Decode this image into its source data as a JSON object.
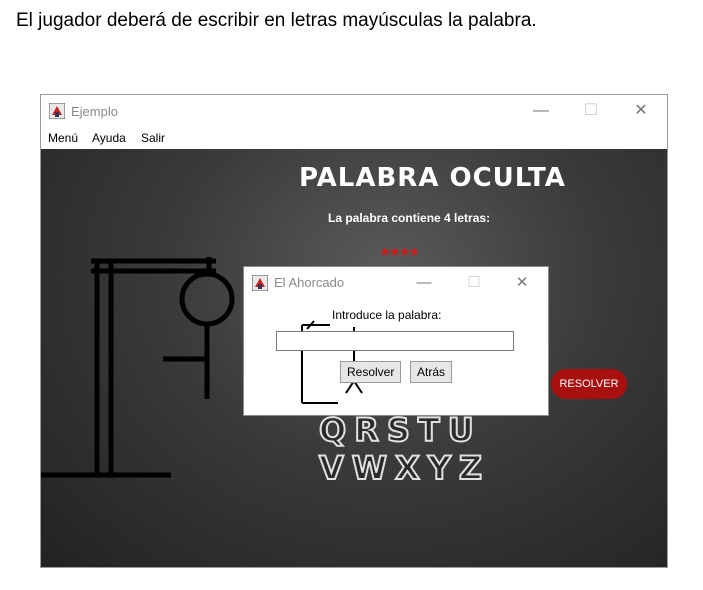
{
  "caption": "El jugador deberá de escribir en letras mayúsculas la palabra.",
  "window": {
    "title": "Ejemplo",
    "controls": {
      "minimize": "—",
      "maximize": "☐",
      "close": "✕"
    }
  },
  "menu": [
    "Menú",
    "Ayuda",
    "Salir"
  ],
  "board": {
    "heading": "PALABRA OCULTA",
    "subheading": "La palabra contiene 4 letras:",
    "masked_word": "****",
    "letters_row1": "QRSTU",
    "letters_row2": "VWXYZ",
    "solve_button": "RESOLVER"
  },
  "dialog": {
    "title": "El Ahorcado",
    "controls": {
      "minimize": "—",
      "maximize": "☐",
      "close": "✕"
    },
    "label": "Introduce la palabra:",
    "input_value": "",
    "buttons": {
      "resolve": "Resolver",
      "back": "Atrás"
    }
  },
  "colors": {
    "board_bg": "#3a3a3a",
    "masked": "#d01818",
    "solve_button": "#a81010"
  }
}
